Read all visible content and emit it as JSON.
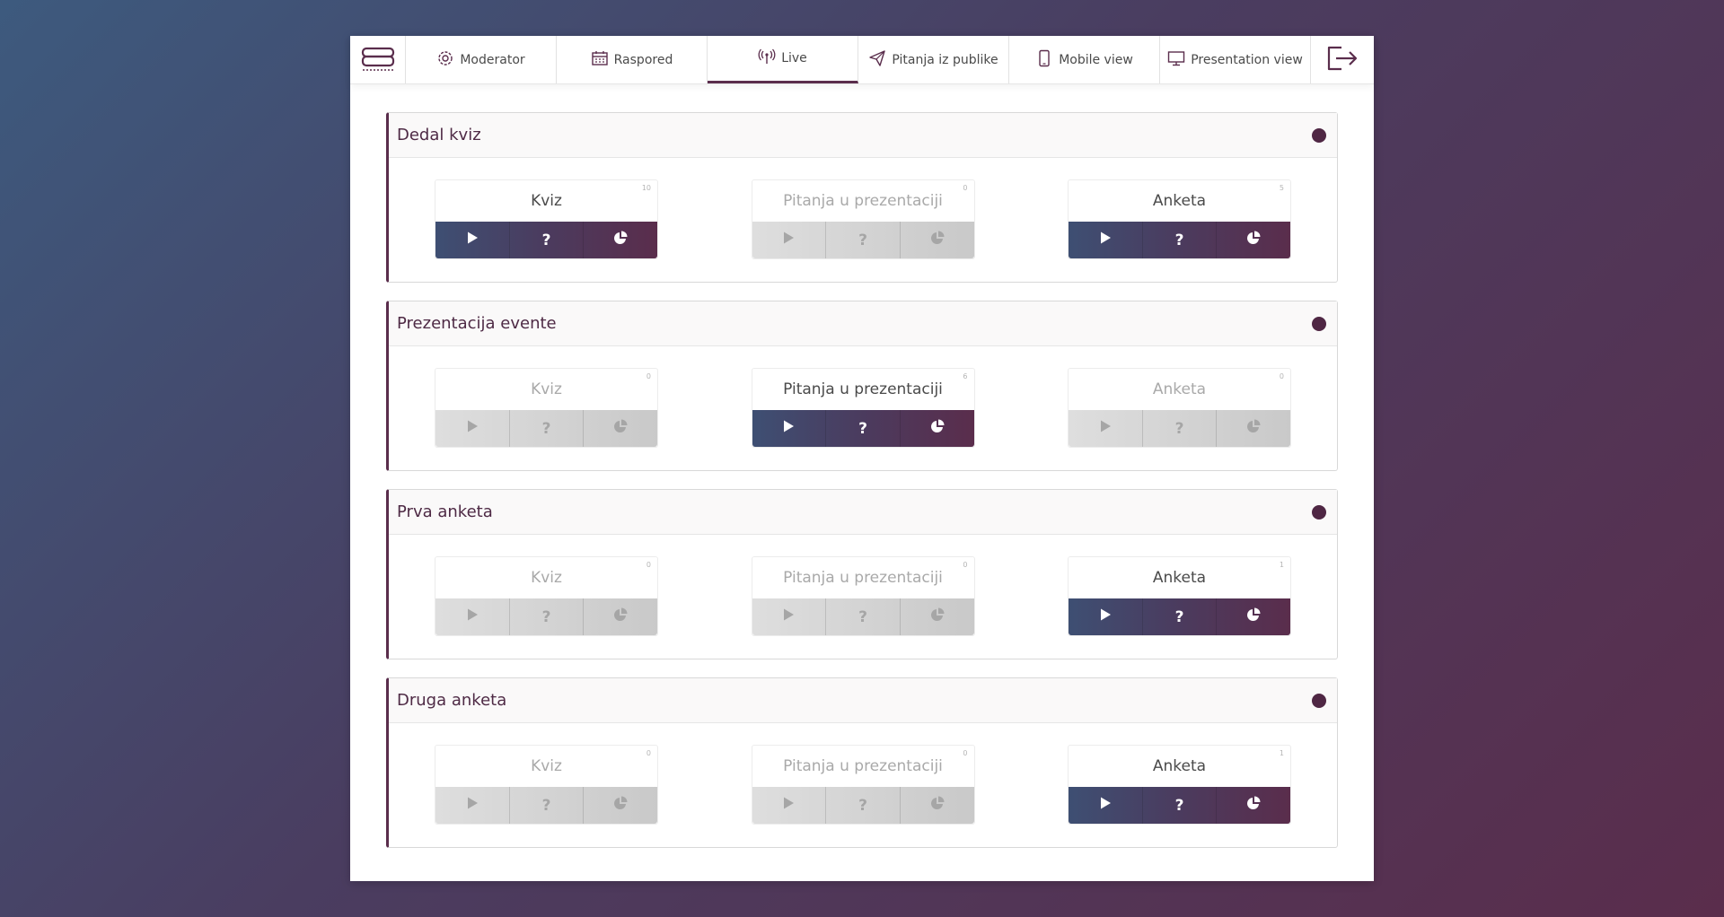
{
  "nav": {
    "logo_icon": "evente-logo-icon",
    "tabs": [
      {
        "label": "Moderator",
        "icon": "gear-icon"
      },
      {
        "label": "Raspored",
        "icon": "calendar-icon"
      },
      {
        "label": "Live",
        "icon": "broadcast-icon",
        "active": true
      },
      {
        "label": "Pitanja iz publike",
        "icon": "paper-plane-icon"
      },
      {
        "label": "Mobile view",
        "icon": "phone-icon"
      },
      {
        "label": "Presentation view",
        "icon": "monitor-icon"
      }
    ],
    "logout_icon": "logout-icon"
  },
  "colors": {
    "accent": "#5a2d4c",
    "gradient_start": "#3e4f73",
    "gradient_end": "#5a2d4c"
  },
  "events": [
    {
      "title": "Dedal kviz",
      "cards": [
        {
          "label": "Kviz",
          "count": "10",
          "active": true
        },
        {
          "label": "Pitanja u prezentaciji",
          "count": "0",
          "active": false
        },
        {
          "label": "Anketa",
          "count": "5",
          "active": true
        }
      ]
    },
    {
      "title": "Prezentacija evente",
      "cards": [
        {
          "label": "Kviz",
          "count": "0",
          "active": false
        },
        {
          "label": "Pitanja u prezentaciji",
          "count": "6",
          "active": true
        },
        {
          "label": "Anketa",
          "count": "0",
          "active": false
        }
      ]
    },
    {
      "title": "Prva anketa",
      "cards": [
        {
          "label": "Kviz",
          "count": "0",
          "active": false
        },
        {
          "label": "Pitanja u prezentaciji",
          "count": "0",
          "active": false
        },
        {
          "label": "Anketa",
          "count": "1",
          "active": true
        }
      ]
    },
    {
      "title": "Druga anketa",
      "cards": [
        {
          "label": "Kviz",
          "count": "0",
          "active": false
        },
        {
          "label": "Pitanja u prezentaciji",
          "count": "0",
          "active": false
        },
        {
          "label": "Anketa",
          "count": "1",
          "active": true
        }
      ]
    }
  ],
  "actions": {
    "play_icon": "play-icon",
    "question_mark": "?",
    "chart_icon": "pie-chart-icon"
  }
}
